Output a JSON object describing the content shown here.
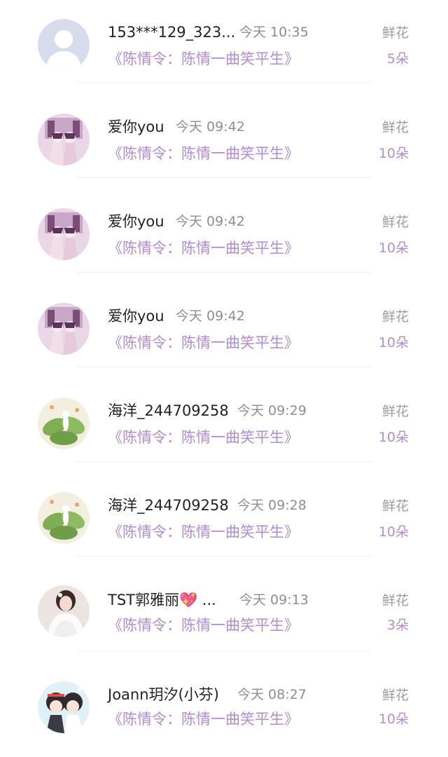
{
  "entries": [
    {
      "name": "153***129_323...",
      "time": "今天 10:35",
      "book": "《陈情令：陈情一曲笑平生》",
      "gift_label": "鲜花",
      "count": "5朵",
      "avatar_icon": "default-user-avatar-icon"
    },
    {
      "name": "爱你you",
      "time": "今天 09:42",
      "book": "《陈情令：陈情一曲笑平生》",
      "gift_label": "鲜花",
      "count": "10朵",
      "avatar_icon": "anime-couple-avatar-icon"
    },
    {
      "name": "爱你you",
      "time": "今天 09:42",
      "book": "《陈情令：陈情一曲笑平生》",
      "gift_label": "鲜花",
      "count": "10朵",
      "avatar_icon": "anime-couple-avatar-icon"
    },
    {
      "name": "爱你you",
      "time": "今天 09:42",
      "book": "《陈情令：陈情一曲笑平生》",
      "gift_label": "鲜花",
      "count": "10朵",
      "avatar_icon": "anime-couple-avatar-icon"
    },
    {
      "name": "海洋_244709258",
      "time": "今天 09:29",
      "book": "《陈情令：陈情一曲笑平生》",
      "gift_label": "鲜花",
      "count": "10朵",
      "avatar_icon": "lotus-leaf-avatar-icon"
    },
    {
      "name": "海洋_244709258",
      "time": "今天 09:28",
      "book": "《陈情令：陈情一曲笑平生》",
      "gift_label": "鲜花",
      "count": "10朵",
      "avatar_icon": "lotus-leaf-avatar-icon"
    },
    {
      "name": "TST郭雅丽💖 ...",
      "time": "今天 09:13",
      "book": "《陈情令：陈情一曲笑平生》",
      "gift_label": "鲜花",
      "count": "3朵",
      "avatar_icon": "bride-photo-avatar-icon"
    },
    {
      "name": "Joann玥汐(小芬)",
      "time": "今天 08:27",
      "book": "《陈情令：陈情一曲笑平生》",
      "gift_label": "鲜花",
      "count": "10朵",
      "avatar_icon": "chibi-anime-avatar-icon"
    }
  ],
  "colors": {
    "accent_purple": "#b28ad6",
    "name_text": "#222222",
    "time_text": "#8e8e8e",
    "gift_label_text": "#9c9c9c"
  }
}
